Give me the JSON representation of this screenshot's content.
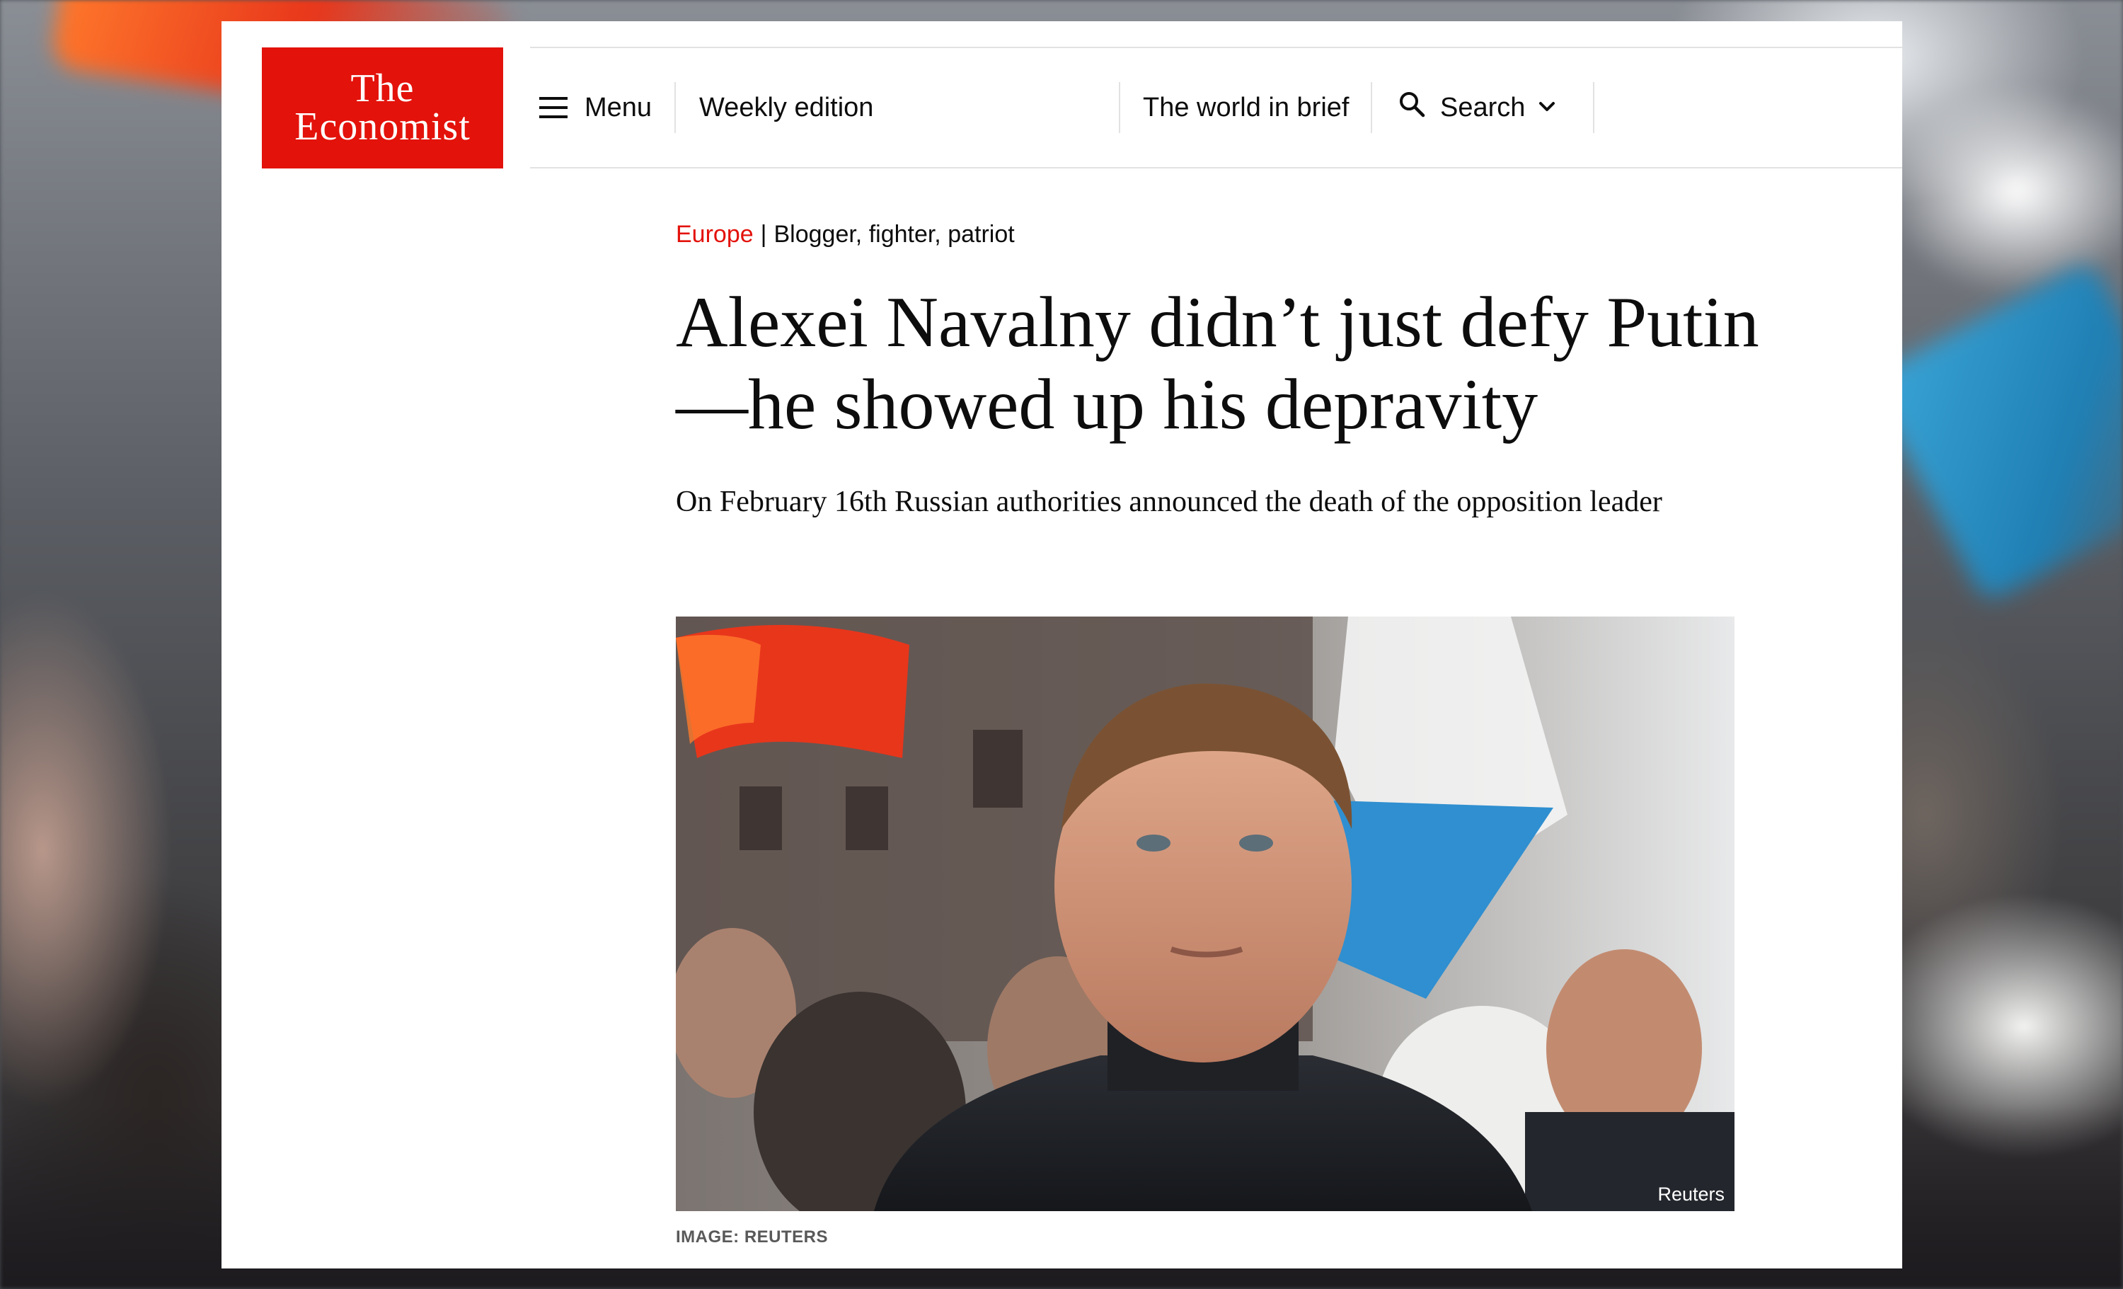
{
  "brand": {
    "logo_line1": "The",
    "logo_line2": "Economist",
    "color": "#e3120b"
  },
  "nav": {
    "menu_label": "Menu",
    "weekly_label": "Weekly edition",
    "world_label": "The world in brief",
    "search_label": "Search",
    "menu_icon": "hamburger-icon",
    "search_icon": "magnifier-icon",
    "search_chevron_icon": "chevron-down-icon"
  },
  "article": {
    "section": "Europe",
    "separator": "|",
    "fly_title": "Blogger, fighter, patriot",
    "headline": "Alexei Navalny didn’t just defy Putin—he showed up his depravity",
    "standfirst": "On February 16th Russian authorities announced the death of the opposition leader",
    "image_credit": "Reuters",
    "image_caption": "IMAGE: REUTERS"
  }
}
